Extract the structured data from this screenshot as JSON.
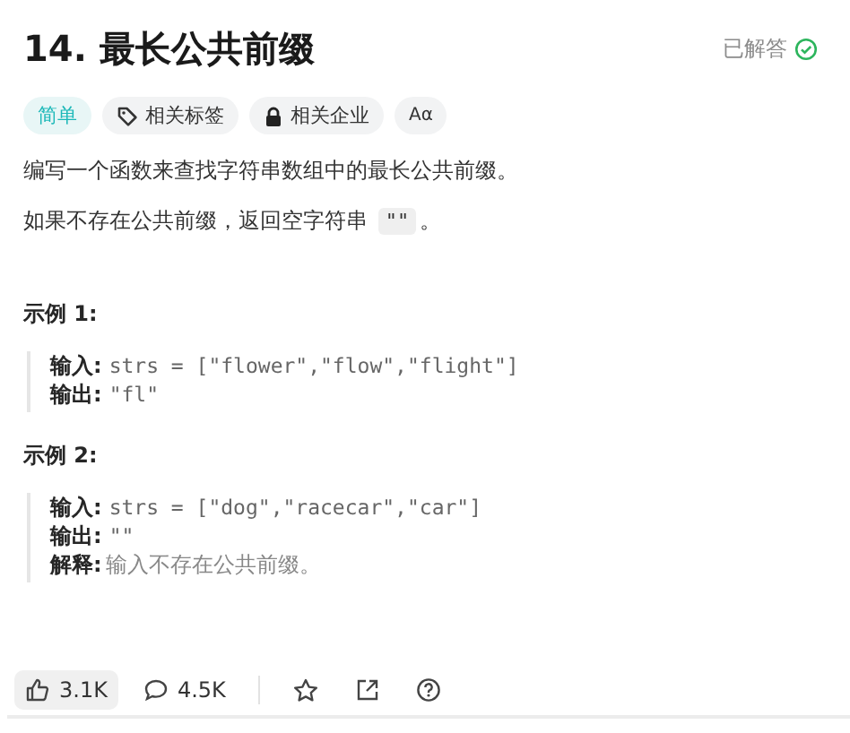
{
  "title": "14. 最长公共前缀",
  "status": {
    "label": "已解答",
    "solved": true
  },
  "tags": [
    {
      "kind": "difficulty",
      "label": "简单"
    },
    {
      "kind": "topic",
      "label": "相关标签"
    },
    {
      "kind": "company",
      "label": "相关企业"
    },
    {
      "kind": "font",
      "label": "Aα"
    }
  ],
  "paragraphs": [
    {
      "text": "编写一个函数来查找字符串数组中的最长公共前缀。"
    },
    {
      "text": "如果不存在公共前缀，返回空字符串 ",
      "code": "\"\"",
      "after": "。"
    }
  ],
  "examples": [
    {
      "heading": "示例 1:",
      "lines": [
        {
          "label": "输入:",
          "value": "strs = [\"flower\",\"flow\",\"flight\"]",
          "kind": "code"
        },
        {
          "label": "输出:",
          "value": "\"fl\"",
          "kind": "code"
        }
      ]
    },
    {
      "heading": "示例 2:",
      "lines": [
        {
          "label": "输入:",
          "value": "strs = [\"dog\",\"racecar\",\"car\"]",
          "kind": "code"
        },
        {
          "label": "输出:",
          "value": "\"\"",
          "kind": "code"
        },
        {
          "label": "解释:",
          "value": "输入不存在公共前缀。",
          "kind": "text"
        }
      ]
    }
  ],
  "footer": {
    "likes": "3.1K",
    "comments": "4.5K"
  }
}
